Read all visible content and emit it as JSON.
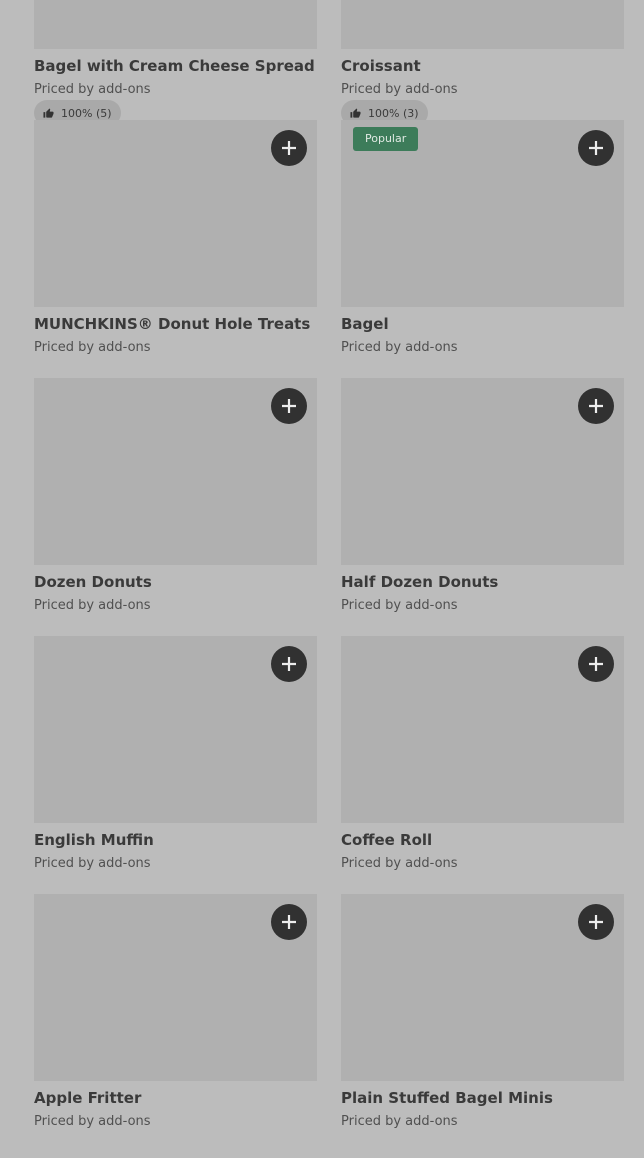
{
  "products": [
    {
      "name": "Bagel with Cream Cheese Spread",
      "price": "Priced by add-ons",
      "rating": "100% (5)"
    },
    {
      "name": "Croissant",
      "price": "Priced by add-ons",
      "rating": "100% (3)"
    },
    {
      "name": "MUNCHKINS® Donut Hole Treats",
      "price": "Priced by add-ons"
    },
    {
      "name": "Bagel",
      "price": "Priced by add-ons",
      "badge": "Popular"
    },
    {
      "name": "Dozen Donuts",
      "price": "Priced by add-ons"
    },
    {
      "name": "Half Dozen Donuts",
      "price": "Priced by add-ons"
    },
    {
      "name": "English Muffin",
      "price": "Priced by add-ons"
    },
    {
      "name": "Coffee Roll",
      "price": "Priced by add-ons"
    },
    {
      "name": "Apple Fritter",
      "price": "Priced by add-ons"
    },
    {
      "name": "Plain Stuffed Bagel Minis",
      "price": "Priced by add-ons"
    }
  ],
  "icons": {
    "add": "plus-icon",
    "rating": "thumbs-up-icon"
  }
}
